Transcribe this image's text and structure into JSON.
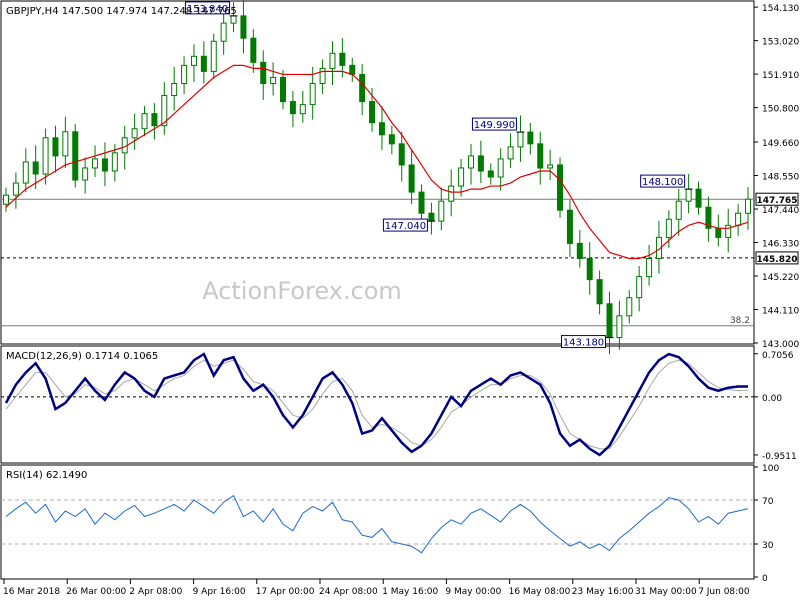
{
  "chart_data": [
    {
      "type": "candlestick",
      "panel": "price",
      "title": "GBPJPY,H4  147.500 147.974 147.248 147.765",
      "ylim": [
        143.0,
        154.3
      ],
      "y_ticks": [
        "154.130",
        "153.020",
        "151.910",
        "150.800",
        "149.660",
        "148.550",
        "147.440",
        "146.330",
        "145.220",
        "144.110",
        "143.000"
      ],
      "y_tick_values": [
        154.13,
        153.02,
        151.91,
        150.8,
        149.66,
        148.55,
        147.44,
        146.33,
        145.22,
        144.11,
        143.0
      ],
      "x_ticks": [
        "16 Mar 2018",
        "26 Mar 00:00",
        "2 Apr 08:00",
        "9 Apr 16:00",
        "17 Apr 00:00",
        "24 Apr 08:00",
        "1 May 16:00",
        "9 May 00:00",
        "16 May 08:00",
        "23 May 16:00",
        "31 May 00:00",
        "7 Jun 08:00"
      ],
      "close_series": [
        147.9,
        148.3,
        149.0,
        148.6,
        149.8,
        149.2,
        150.0,
        148.4,
        148.8,
        149.1,
        148.7,
        149.3,
        149.8,
        150.1,
        150.6,
        150.2,
        151.2,
        151.6,
        152.2,
        152.5,
        152.0,
        153.0,
        153.6,
        153.84,
        153.1,
        152.3,
        151.6,
        151.8,
        151.0,
        150.6,
        150.9,
        151.6,
        152.1,
        152.6,
        152.2,
        151.9,
        151.0,
        150.3,
        149.9,
        149.6,
        148.9,
        148.0,
        147.3,
        147.04,
        147.7,
        148.2,
        148.8,
        149.2,
        148.7,
        148.5,
        149.1,
        149.5,
        149.99,
        149.6,
        148.8,
        148.9,
        147.4,
        146.3,
        145.8,
        145.1,
        144.3,
        143.18,
        143.9,
        144.5,
        145.2,
        145.8,
        146.5,
        147.1,
        147.7,
        148.1,
        147.5,
        146.8,
        146.5,
        146.9,
        147.3,
        147.765
      ],
      "ma_series": [
        147.5,
        147.8,
        148.1,
        148.3,
        148.5,
        148.7,
        148.9,
        149.0,
        149.1,
        149.2,
        149.3,
        149.4,
        149.5,
        149.7,
        149.9,
        150.1,
        150.3,
        150.6,
        150.9,
        151.2,
        151.5,
        151.8,
        152.0,
        152.2,
        152.2,
        152.1,
        152.1,
        152.0,
        151.9,
        151.9,
        151.9,
        151.9,
        152.0,
        152.0,
        152.0,
        151.9,
        151.6,
        151.2,
        150.8,
        150.3,
        149.9,
        149.4,
        148.9,
        148.4,
        148.1,
        148.0,
        148.0,
        148.1,
        148.1,
        148.2,
        148.2,
        148.3,
        148.5,
        148.6,
        148.7,
        148.7,
        148.4,
        147.9,
        147.3,
        146.8,
        146.4,
        146.0,
        145.9,
        145.8,
        145.8,
        145.9,
        146.1,
        146.4,
        146.7,
        146.9,
        147.0,
        146.9,
        146.8,
        146.8,
        146.9,
        147.0
      ],
      "labels": [
        {
          "text": "153.840",
          "value": 153.84,
          "index": 23
        },
        {
          "text": "147.040",
          "value": 147.04,
          "index": 43
        },
        {
          "text": "149.990",
          "value": 149.99,
          "index": 52
        },
        {
          "text": "148.100",
          "value": 148.1,
          "index": 69
        },
        {
          "text": "143.180",
          "value": 143.18,
          "index": 61
        }
      ],
      "hlines": [
        {
          "value": 147.765,
          "style": "solid",
          "label": "147.765",
          "highlight": true
        },
        {
          "value": 145.82,
          "style": "dashed",
          "label": "145.820",
          "highlight": true
        },
        {
          "value": 143.57,
          "style": "solid",
          "label": "38.2"
        }
      ],
      "ma_color": "#e00000",
      "candle_color": "#007a00"
    },
    {
      "type": "line",
      "panel": "macd",
      "title": "MACD(12,26,9) 0.1714 0.1065",
      "ylim": [
        -1.05,
        0.8
      ],
      "y_ticks": [
        "0.7056",
        "0.00",
        "-0.9511"
      ],
      "y_tick_values": [
        0.7056,
        0.0,
        -0.9511
      ],
      "series": [
        {
          "values": [
            -0.1,
            0.2,
            0.4,
            0.55,
            0.3,
            -0.2,
            -0.1,
            0.1,
            0.3,
            0.1,
            -0.05,
            0.2,
            0.4,
            0.3,
            0.1,
            0.0,
            0.3,
            0.35,
            0.4,
            0.6,
            0.7,
            0.35,
            0.6,
            0.65,
            0.3,
            0.1,
            0.2,
            0.0,
            -0.3,
            -0.5,
            -0.3,
            0.0,
            0.3,
            0.4,
            0.2,
            -0.1,
            -0.6,
            -0.55,
            -0.35,
            -0.55,
            -0.75,
            -0.9,
            -0.8,
            -0.6,
            -0.3,
            0.0,
            -0.15,
            0.1,
            0.2,
            0.3,
            0.2,
            0.35,
            0.4,
            0.3,
            0.2,
            -0.1,
            -0.6,
            -0.8,
            -0.7,
            -0.85,
            -0.95,
            -0.8,
            -0.5,
            -0.2,
            0.1,
            0.4,
            0.6,
            0.7,
            0.65,
            0.5,
            0.3,
            0.15,
            0.1,
            0.15,
            0.17,
            0.17
          ]
        },
        {
          "values": [
            -0.2,
            0.0,
            0.2,
            0.4,
            0.4,
            0.2,
            0.0,
            0.05,
            0.2,
            0.15,
            0.05,
            0.1,
            0.25,
            0.3,
            0.2,
            0.1,
            0.2,
            0.3,
            0.35,
            0.5,
            0.6,
            0.5,
            0.55,
            0.6,
            0.45,
            0.25,
            0.2,
            0.1,
            -0.1,
            -0.3,
            -0.35,
            -0.2,
            0.05,
            0.25,
            0.3,
            0.1,
            -0.3,
            -0.5,
            -0.45,
            -0.5,
            -0.6,
            -0.75,
            -0.8,
            -0.7,
            -0.5,
            -0.25,
            -0.15,
            0.0,
            0.1,
            0.2,
            0.2,
            0.3,
            0.35,
            0.35,
            0.25,
            0.05,
            -0.3,
            -0.6,
            -0.7,
            -0.8,
            -0.85,
            -0.85,
            -0.65,
            -0.4,
            -0.15,
            0.15,
            0.4,
            0.55,
            0.6,
            0.55,
            0.4,
            0.25,
            0.15,
            0.12,
            0.1,
            0.11
          ]
        }
      ],
      "macd_color": "#000080",
      "signal_color": "#a8a8a8"
    },
    {
      "type": "line",
      "panel": "rsi",
      "title": "RSI(14) 62.1490",
      "ylim": [
        0,
        100
      ],
      "y_ticks": [
        "100",
        "70",
        "30",
        "0"
      ],
      "y_tick_values": [
        100,
        70,
        30,
        0
      ],
      "levels": [
        70,
        30
      ],
      "series": [
        {
          "values": [
            55,
            62,
            68,
            58,
            66,
            50,
            60,
            55,
            62,
            48,
            58,
            52,
            60,
            65,
            55,
            58,
            62,
            66,
            60,
            70,
            64,
            58,
            68,
            74,
            55,
            60,
            50,
            62,
            48,
            42,
            58,
            64,
            60,
            68,
            52,
            50,
            38,
            36,
            44,
            32,
            30,
            28,
            22,
            35,
            45,
            52,
            48,
            58,
            62,
            56,
            50,
            60,
            66,
            60,
            50,
            42,
            35,
            28,
            32,
            26,
            30,
            24,
            35,
            42,
            50,
            58,
            64,
            72,
            70,
            62,
            50,
            55,
            48,
            58,
            60,
            62
          ]
        }
      ],
      "rsi_color": "#1e6ad0"
    }
  ],
  "watermark": "ActionForex.com"
}
